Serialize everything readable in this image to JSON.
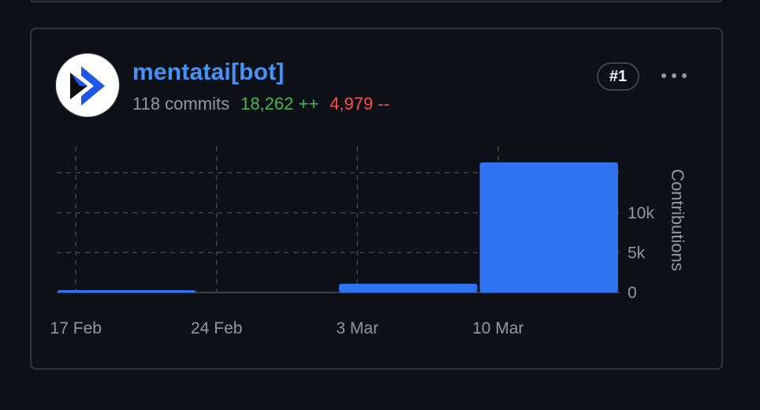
{
  "contributor": {
    "username": "mentatai[bot]",
    "commits_text": "118 commits",
    "additions_text": "18,262 ++",
    "deletions_text": "4,979 --",
    "rank": "#1",
    "avatar_icon": "mentat-logo-icon",
    "more_icon": "kebab-horizontal-icon"
  },
  "colors": {
    "username": "#4493f8",
    "additions": "#3fb950",
    "deletions": "#f85149",
    "bar": "#2f73f0"
  },
  "chart_data": {
    "type": "bar",
    "categories": [
      "17 Feb",
      "24 Feb",
      "3 Mar",
      "10 Mar"
    ],
    "values": [
      200,
      0,
      1100,
      16300
    ],
    "ylabel": "Contributions",
    "yticks": [
      {
        "value": 0,
        "label": "0"
      },
      {
        "value": 5000,
        "label": "5k"
      },
      {
        "value": 10000,
        "label": "10k"
      }
    ],
    "ylim": [
      0,
      16300
    ],
    "grid": true
  }
}
